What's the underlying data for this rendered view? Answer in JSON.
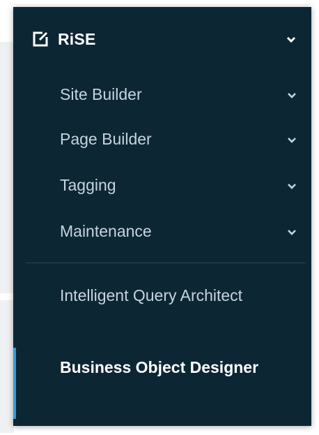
{
  "menu": {
    "header": {
      "label": "RiSE",
      "icon": "edit-square-icon",
      "expanded": true
    },
    "submenus": [
      {
        "label": "Site Builder",
        "icon": "chevron-down-icon"
      },
      {
        "label": "Page Builder",
        "icon": "chevron-down-icon"
      },
      {
        "label": "Tagging",
        "icon": "chevron-down-icon"
      },
      {
        "label": "Maintenance",
        "icon": "chevron-down-icon"
      }
    ],
    "links": [
      {
        "label": "Intelligent Query Architect",
        "active": false
      },
      {
        "label": "Business Object Designer",
        "active": true
      }
    ]
  },
  "colors": {
    "panel_bg": "#0d2634",
    "text": "#c5d4dd",
    "active_text": "#ffffff",
    "active_indicator": "#2b9fd8"
  }
}
